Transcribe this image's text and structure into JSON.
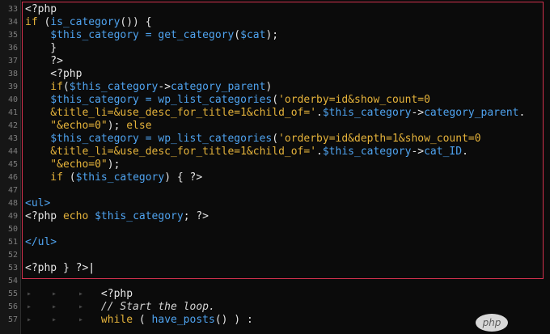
{
  "editor": {
    "lines": [
      {
        "n": "33",
        "tokens": [
          {
            "t": "<?php",
            "c": "php"
          }
        ]
      },
      {
        "n": "34",
        "tokens": [
          {
            "t": "if ",
            "c": "kw"
          },
          {
            "t": "(",
            "c": "plain"
          },
          {
            "t": "is_category",
            "c": "fn"
          },
          {
            "t": "()) {",
            "c": "plain"
          }
        ]
      },
      {
        "n": "35",
        "tokens": [
          {
            "t": "    $this_category",
            "c": "var"
          },
          {
            "t": " = ",
            "c": "fn"
          },
          {
            "t": "get_category",
            "c": "fn"
          },
          {
            "t": "(",
            "c": "plain"
          },
          {
            "t": "$cat",
            "c": "var"
          },
          {
            "t": ");",
            "c": "plain"
          }
        ]
      },
      {
        "n": "36",
        "tokens": [
          {
            "t": "    }",
            "c": "plain"
          }
        ]
      },
      {
        "n": "37",
        "tokens": [
          {
            "t": "    ?>",
            "c": "php"
          }
        ]
      },
      {
        "n": "38",
        "tokens": [
          {
            "t": "    <?php",
            "c": "php"
          }
        ]
      },
      {
        "n": "39",
        "tokens": [
          {
            "t": "    if",
            "c": "kw"
          },
          {
            "t": "(",
            "c": "plain"
          },
          {
            "t": "$this_category",
            "c": "var"
          },
          {
            "t": "->",
            "c": "plain"
          },
          {
            "t": "category_parent",
            "c": "fn"
          },
          {
            "t": ")",
            "c": "plain"
          }
        ]
      },
      {
        "n": "40",
        "tokens": [
          {
            "t": "    $this_category",
            "c": "var"
          },
          {
            "t": " = ",
            "c": "fn"
          },
          {
            "t": "wp_list_categories",
            "c": "fn"
          },
          {
            "t": "(",
            "c": "plain"
          },
          {
            "t": "'orderby=id&show_count=0",
            "c": "str"
          }
        ]
      },
      {
        "n": "41",
        "tokens": [
          {
            "t": "    &title_li=&use_desc_for_title=1&child_of='",
            "c": "str"
          },
          {
            "t": ".",
            "c": "plain"
          },
          {
            "t": "$this_category",
            "c": "var"
          },
          {
            "t": "->",
            "c": "plain"
          },
          {
            "t": "category_parent",
            "c": "fn"
          },
          {
            "t": ".",
            "c": "plain"
          }
        ]
      },
      {
        "n": "42",
        "tokens": [
          {
            "t": "    \"&echo=0\"",
            "c": "str"
          },
          {
            "t": "); ",
            "c": "plain"
          },
          {
            "t": "else",
            "c": "kw"
          }
        ]
      },
      {
        "n": "43",
        "tokens": [
          {
            "t": "    $this_category",
            "c": "var"
          },
          {
            "t": " = ",
            "c": "fn"
          },
          {
            "t": "wp_list_categories",
            "c": "fn"
          },
          {
            "t": "(",
            "c": "plain"
          },
          {
            "t": "'orderby=id&depth=1&show_count=0",
            "c": "str"
          }
        ]
      },
      {
        "n": "44",
        "tokens": [
          {
            "t": "    &title_li=&use_desc_for_title=1&child_of='",
            "c": "str"
          },
          {
            "t": ".",
            "c": "plain"
          },
          {
            "t": "$this_category",
            "c": "var"
          },
          {
            "t": "->",
            "c": "plain"
          },
          {
            "t": "cat_ID",
            "c": "fn"
          },
          {
            "t": ".",
            "c": "plain"
          }
        ]
      },
      {
        "n": "45",
        "tokens": [
          {
            "t": "    \"&echo=0\"",
            "c": "str"
          },
          {
            "t": ");",
            "c": "plain"
          }
        ]
      },
      {
        "n": "46",
        "tokens": [
          {
            "t": "    if ",
            "c": "kw"
          },
          {
            "t": "(",
            "c": "plain"
          },
          {
            "t": "$this_category",
            "c": "var"
          },
          {
            "t": ") { ?>",
            "c": "plain"
          }
        ]
      },
      {
        "n": "47",
        "tokens": []
      },
      {
        "n": "48",
        "tokens": [
          {
            "t": "<ul>",
            "c": "tag"
          }
        ]
      },
      {
        "n": "49",
        "tokens": [
          {
            "t": "<?php ",
            "c": "php"
          },
          {
            "t": "echo ",
            "c": "kw"
          },
          {
            "t": "$this_category",
            "c": "var"
          },
          {
            "t": "; ?>",
            "c": "plain"
          }
        ]
      },
      {
        "n": "50",
        "tokens": []
      },
      {
        "n": "51",
        "tokens": [
          {
            "t": "</ul>",
            "c": "tag"
          }
        ]
      },
      {
        "n": "52",
        "tokens": []
      },
      {
        "n": "53",
        "tokens": [
          {
            "t": "<?php } ?>",
            "c": "php"
          },
          {
            "t": "|",
            "c": "caret"
          }
        ]
      },
      {
        "n": "54",
        "tokens": []
      },
      {
        "n": "55",
        "tokens": [
          {
            "t": "            <?php",
            "c": "php"
          }
        ]
      },
      {
        "n": "56",
        "tokens": [
          {
            "t": "            // Start the loop.",
            "c": "cmt"
          }
        ]
      },
      {
        "n": "57",
        "tokens": [
          {
            "t": "            while ",
            "c": "kw"
          },
          {
            "t": "( ",
            "c": "plain"
          },
          {
            "t": "have_posts",
            "c": "fn"
          },
          {
            "t": "() ) :",
            "c": "plain"
          }
        ]
      }
    ],
    "guide_glyph": "▸"
  },
  "watermark": {
    "text": "php"
  },
  "colors": {
    "background": "#0b0b0b",
    "selection_border": "#d0314d",
    "keyword": "#e5b33b",
    "function": "#4fa3ef",
    "plain": "#e6e6e6"
  }
}
